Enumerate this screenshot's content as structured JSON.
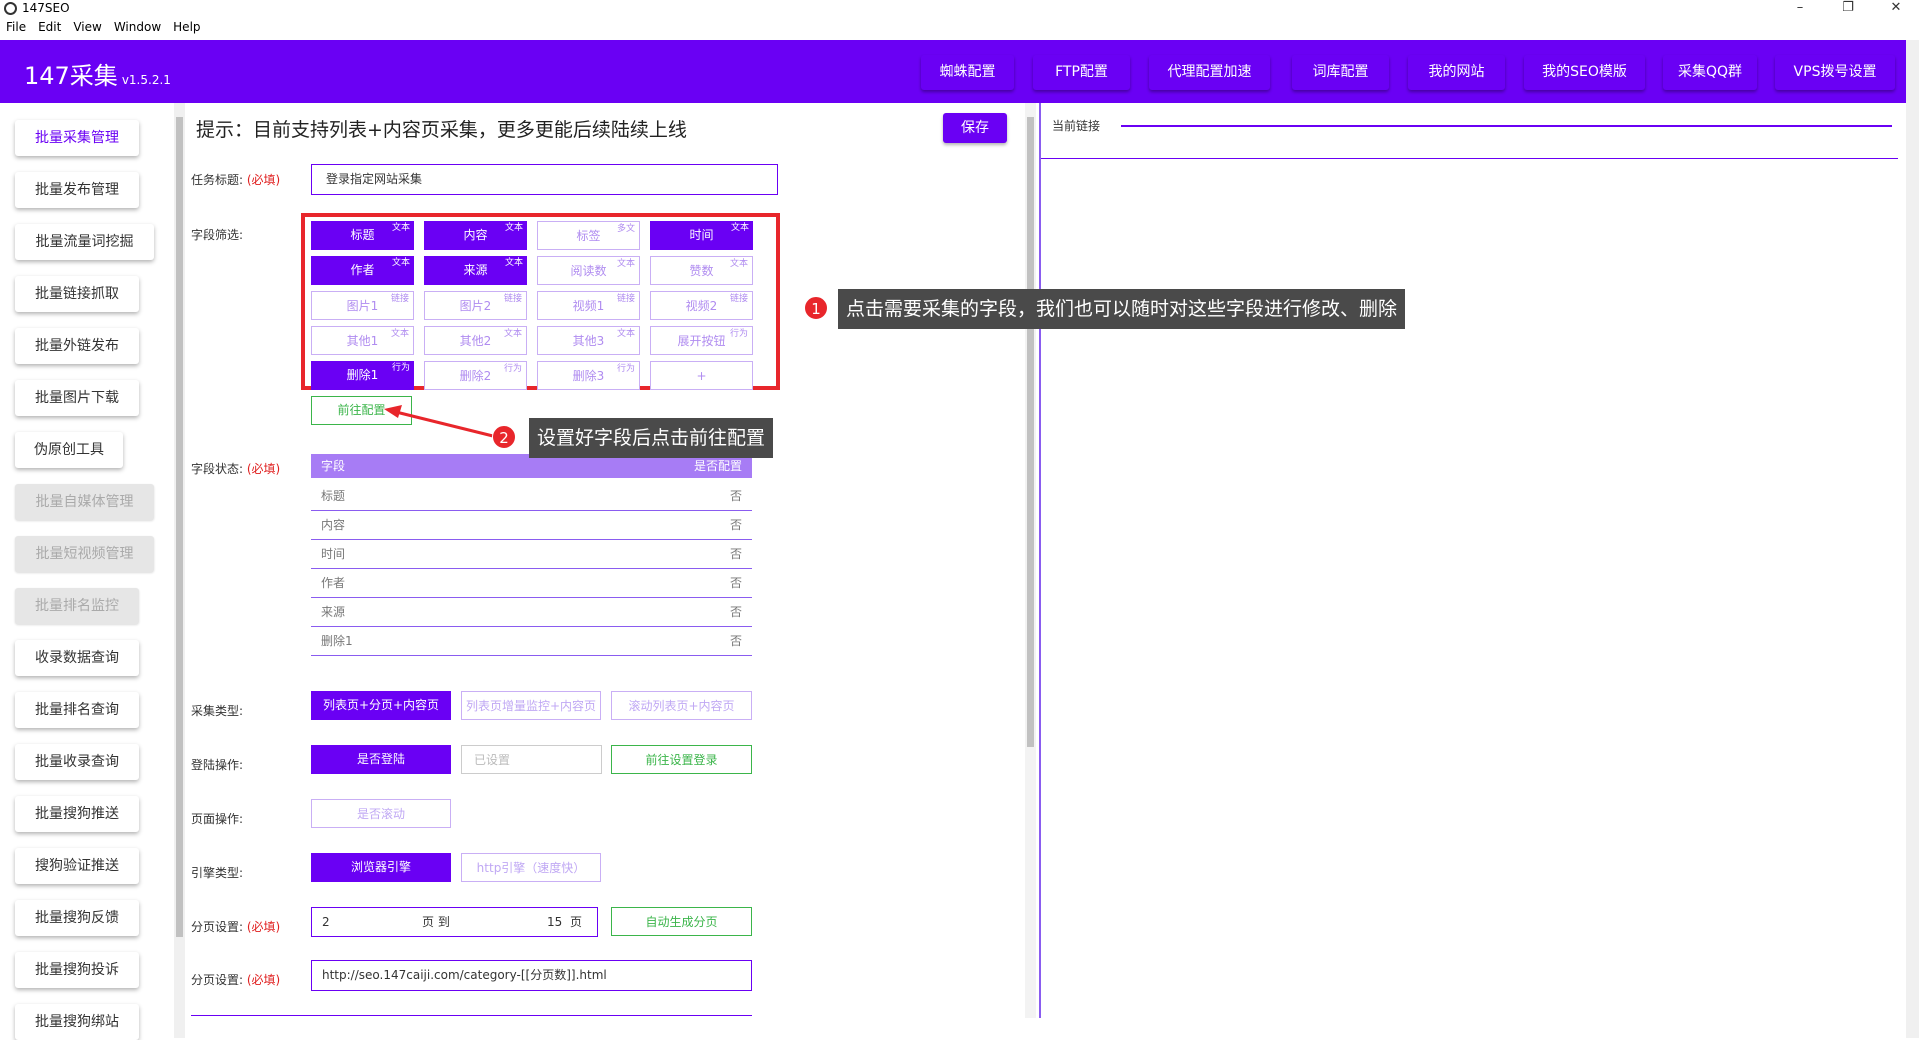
{
  "window": {
    "title": "147SEO",
    "minimize": "–",
    "maximize": "❐",
    "close": "✕"
  },
  "menu": [
    "File",
    "Edit",
    "View",
    "Window",
    "Help"
  ],
  "header": {
    "brand": "147采集",
    "version": "v1.5.2.1",
    "nav": [
      "蜘蛛配置",
      "FTP配置",
      "代理配置加速",
      "词库配置",
      "我的网站",
      "我的SEO模版",
      "采集QQ群",
      "VPS拨号设置"
    ]
  },
  "sidebar": {
    "items": [
      {
        "label": "批量采集管理",
        "state": "active"
      },
      {
        "label": "批量发布管理",
        "state": "normal"
      },
      {
        "label": "批量流量词挖掘",
        "state": "normal"
      },
      {
        "label": "批量链接抓取",
        "state": "normal"
      },
      {
        "label": "批量外链发布",
        "state": "normal"
      },
      {
        "label": "批量图片下载",
        "state": "normal"
      },
      {
        "label": "伪原创工具",
        "state": "normal"
      },
      {
        "label": "批量自媒体管理",
        "state": "disabled"
      },
      {
        "label": "批量短视频管理",
        "state": "disabled"
      },
      {
        "label": "批量排名监控",
        "state": "disabled"
      },
      {
        "label": "收录数据查询",
        "state": "normal"
      },
      {
        "label": "批量排名查询",
        "state": "normal"
      },
      {
        "label": "批量收录查询",
        "state": "normal"
      },
      {
        "label": "批量搜狗推送",
        "state": "normal"
      },
      {
        "label": "搜狗验证推送",
        "state": "normal"
      },
      {
        "label": "批量搜狗反馈",
        "state": "normal"
      },
      {
        "label": "批量搜狗投诉",
        "state": "normal"
      },
      {
        "label": "批量搜狗绑站",
        "state": "normal"
      }
    ]
  },
  "main": {
    "tip": "提示：目前支持列表+内容页采集，更多更能后续陆续上线",
    "save": "保存",
    "task_label": "任务标题:",
    "required": "(必填)",
    "task_value": "登录指定网站采集",
    "field_filter_label": "字段筛选:",
    "fields": [
      {
        "label": "标题",
        "tag": "文本",
        "on": true
      },
      {
        "label": "内容",
        "tag": "文本",
        "on": true
      },
      {
        "label": "标签",
        "tag": "多文",
        "on": false
      },
      {
        "label": "时间",
        "tag": "文本",
        "on": true
      },
      {
        "label": "作者",
        "tag": "文本",
        "on": true
      },
      {
        "label": "来源",
        "tag": "文本",
        "on": true
      },
      {
        "label": "阅读数",
        "tag": "文本",
        "on": false
      },
      {
        "label": "赞数",
        "tag": "文本",
        "on": false
      },
      {
        "label": "图片1",
        "tag": "链接",
        "on": false
      },
      {
        "label": "图片2",
        "tag": "链接",
        "on": false
      },
      {
        "label": "视频1",
        "tag": "链接",
        "on": false
      },
      {
        "label": "视频2",
        "tag": "链接",
        "on": false
      },
      {
        "label": "其他1",
        "tag": "文本",
        "on": false
      },
      {
        "label": "其他2",
        "tag": "文本",
        "on": false
      },
      {
        "label": "其他3",
        "tag": "文本",
        "on": false
      },
      {
        "label": "展开按钮",
        "tag": "行为",
        "on": false
      },
      {
        "label": "删除1",
        "tag": "行为",
        "on": true
      },
      {
        "label": "删除2",
        "tag": "行为",
        "on": false
      },
      {
        "label": "删除3",
        "tag": "行为",
        "on": false
      },
      {
        "label": "+",
        "tag": "",
        "on": false
      }
    ],
    "goto_config": "前往配置",
    "field_status_label": "字段状态:",
    "status_table": {
      "headers": [
        "字段",
        "是否配置"
      ],
      "rows": [
        [
          "标题",
          "否"
        ],
        [
          "内容",
          "否"
        ],
        [
          "时间",
          "否"
        ],
        [
          "作者",
          "否"
        ],
        [
          "来源",
          "否"
        ],
        [
          "删除1",
          "否"
        ]
      ]
    },
    "collect_type_label": "采集类型:",
    "collect_types": [
      "列表页+分页+内容页",
      "列表页增量监控+内容页",
      "滚动列表页+内容页"
    ],
    "login_label": "登陆操作:",
    "login_opts": [
      "是否登陆",
      "已设置",
      "前往设置登录"
    ],
    "page_op_label": "页面操作:",
    "page_op": "是否滚动",
    "engine_label": "引擎类型:",
    "engines": [
      "浏览器引擎",
      "http引擎（速度快）"
    ],
    "paging_label": "分页设置:",
    "paging_from": "2",
    "paging_to_text": "页 到",
    "paging_end": "15",
    "paging_unit": "页",
    "auto_paging": "自动生成分页",
    "paging_url_label": "分页设置:",
    "paging_url": "http://seo.147caiji.com/category-[[分页数]].html"
  },
  "right": {
    "current_link": "当前链接"
  },
  "callouts": [
    {
      "num": "1",
      "text": "点击需要采集的字段，我们也可以随时对这些字段进行修改、删除"
    },
    {
      "num": "2",
      "text": "设置好字段后点击前往配置"
    }
  ],
  "colors": {
    "brand": "#6a00f4",
    "annotation_red": "#e8262b",
    "green": "#3bb54a"
  }
}
